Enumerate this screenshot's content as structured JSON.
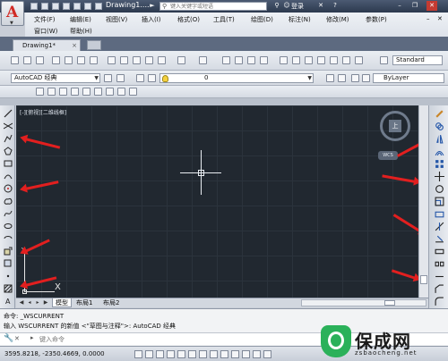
{
  "window": {
    "title": "Drawing1....",
    "search_placeholder": "键入关键字或短语",
    "login_label": "登录"
  },
  "menu": {
    "row1": [
      "文件(F)",
      "编辑(E)",
      "视图(V)",
      "插入(I)",
      "格式(O)",
      "工具(T)",
      "绘图(D)",
      "标注(N)",
      "修改(M)",
      "参数(P)"
    ],
    "row2": [
      "窗口(W)",
      "帮助(H)"
    ]
  },
  "doc_tab": {
    "label": "Drawing1*",
    "close": "×"
  },
  "toolbar": {
    "workspace": "AutoCAD 经典",
    "layer": "0",
    "text_style": "Standard",
    "linetype": "ByLayer"
  },
  "canvas": {
    "viewport_label": "[-][俯视][二维线框]",
    "compass_label": "上",
    "wcs_label": "WCS",
    "ucs_y": "Y",
    "ucs_x": "X"
  },
  "layout_tabs": [
    "模型",
    "布局1",
    "布局2"
  ],
  "command": {
    "history": [
      "命令: _WSCURRENT",
      "输入 WSCURRENT 的新值 <\"草图与注释\">: AutoCAD 经典"
    ],
    "input_placeholder": "键入命令"
  },
  "status": {
    "coordinates": "3595.8218,  -2350.4669, 0.0000"
  },
  "watermark": {
    "brand": "保成网",
    "url": "zsbaocheng.net"
  },
  "colors": {
    "canvas_bg": "#212830",
    "annotation_arrow": "#e21f1f",
    "app_logo": "#d12b25"
  }
}
